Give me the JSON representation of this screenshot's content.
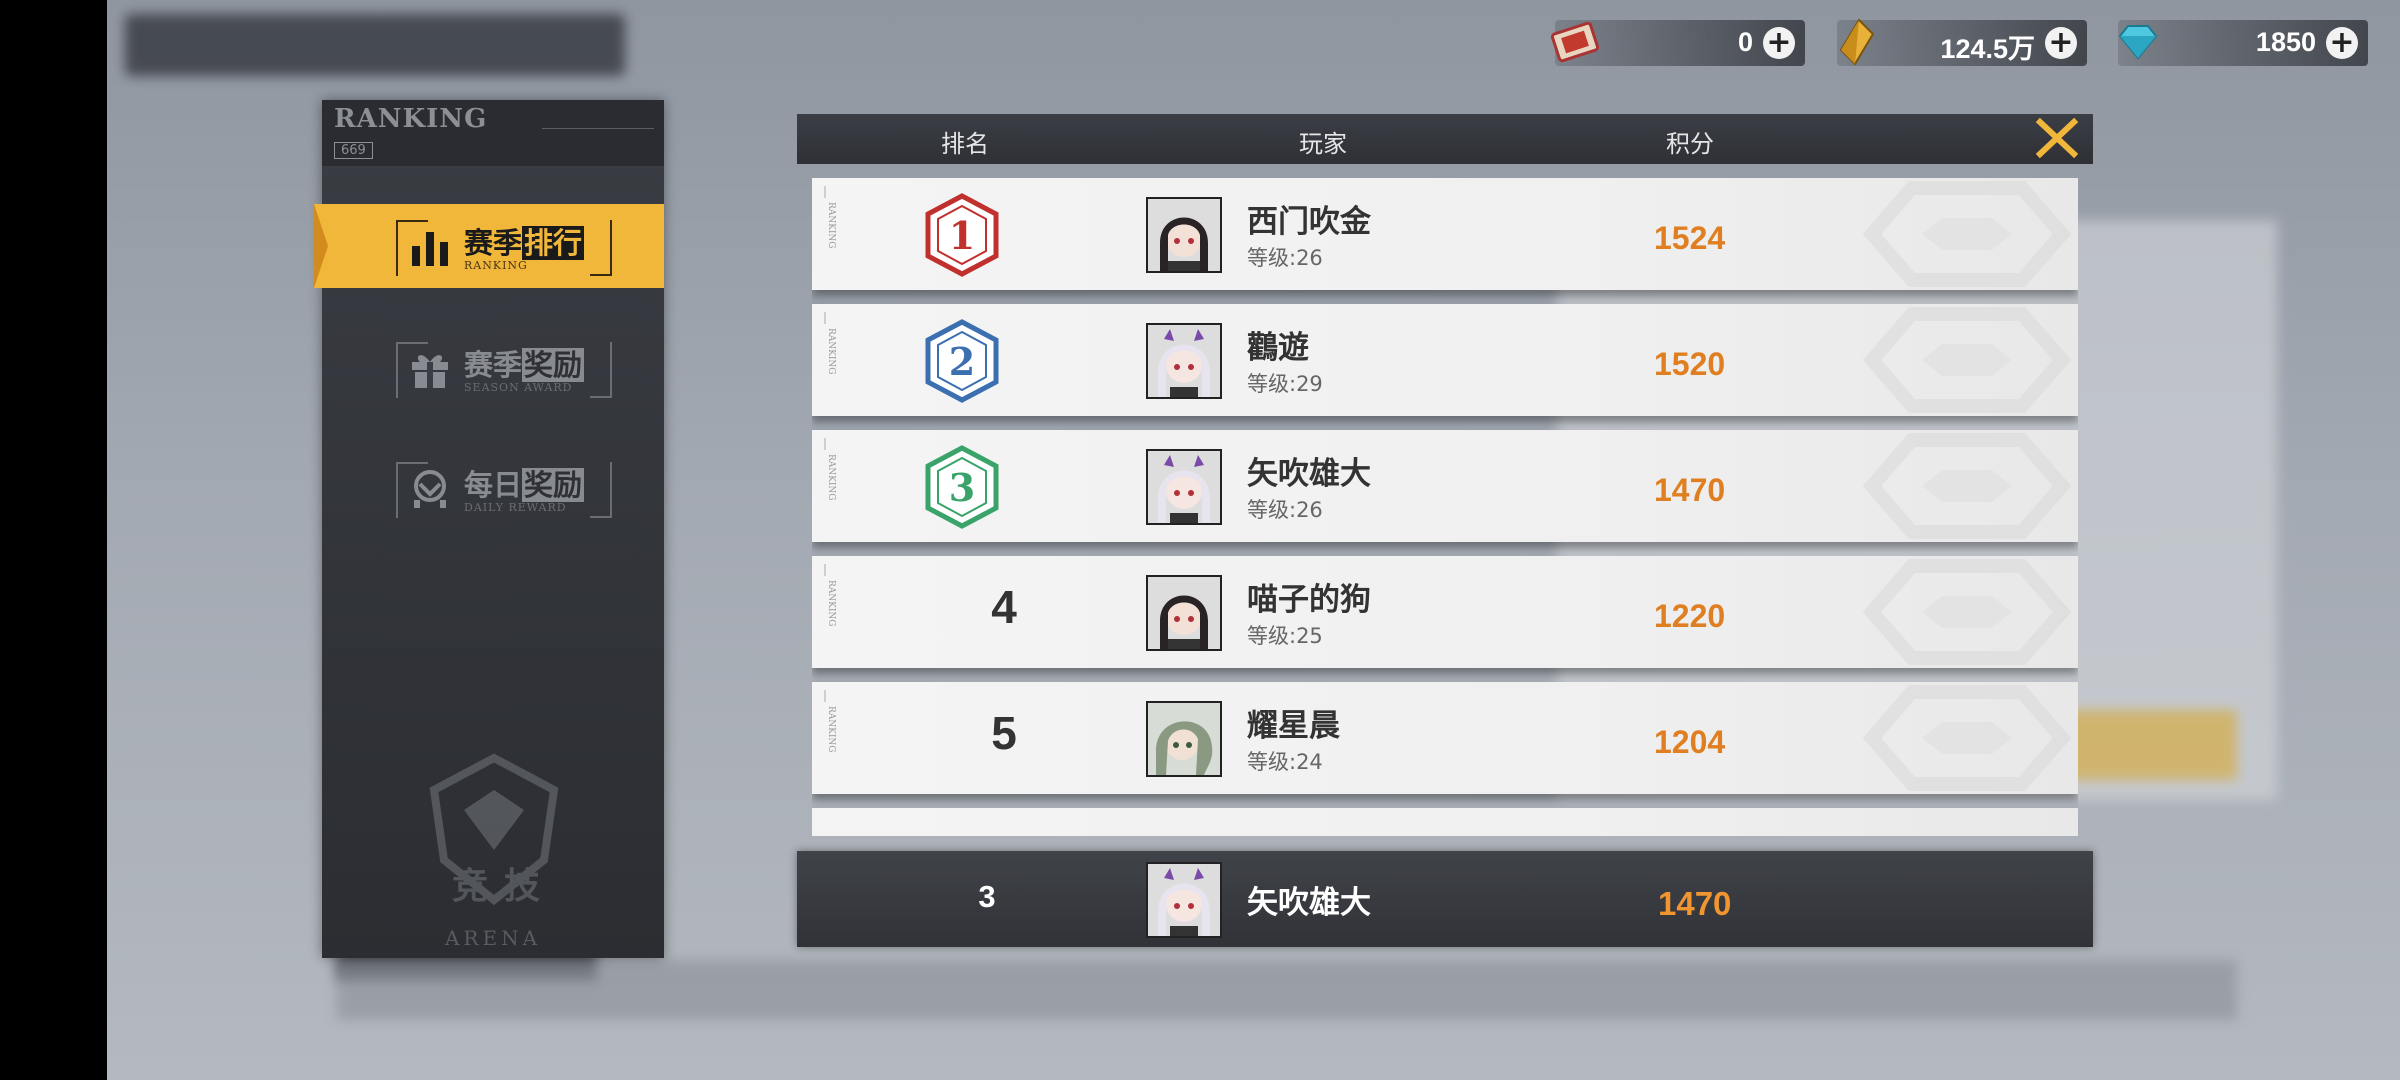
{
  "currencies": [
    {
      "name": "ticket-icon",
      "value": "0"
    },
    {
      "name": "gold-crystal-icon",
      "value": "124.5万"
    },
    {
      "name": "diamond-icon",
      "value": "1850"
    }
  ],
  "sidebar": {
    "header_title": "RANKING",
    "header_num": "669",
    "tabs": [
      {
        "label_a": "赛季",
        "label_b": "排行",
        "sub": "RANKING",
        "active": true
      },
      {
        "label_a": "赛季",
        "label_b": "奖励",
        "sub": "SEASON AWARD",
        "active": false
      },
      {
        "label_a": "每日",
        "label_b": "奖励",
        "sub": "DAILY REWARD",
        "active": false
      }
    ],
    "emblem_text_a": "竞",
    "emblem_text_b": "技",
    "footer": "ARENA"
  },
  "table": {
    "headers": {
      "rank": "排名",
      "player": "玩家",
      "score": "积分"
    },
    "side_tag": "RANKING",
    "rows": [
      {
        "rank": "1",
        "name": "西门吹金",
        "level": "等级:26",
        "score": "1524",
        "avatar": "dark-hair"
      },
      {
        "rank": "2",
        "name": "鸛遊",
        "level": "等级:29",
        "score": "1520",
        "avatar": "white-hair"
      },
      {
        "rank": "3",
        "name": "矢吹雄大",
        "level": "等级:26",
        "score": "1470",
        "avatar": "white-hair"
      },
      {
        "rank": "4",
        "name": "喵子的狗",
        "level": "等级:25",
        "score": "1220",
        "avatar": "dark-hair"
      },
      {
        "rank": "5",
        "name": "耀星晨",
        "level": "等级:24",
        "score": "1204",
        "avatar": "green-hair"
      }
    ]
  },
  "self": {
    "rank": "3",
    "name": "矢吹雄大",
    "score": "1470",
    "avatar": "white-hair"
  },
  "colors": {
    "accent": "#f0b73a",
    "score": "#e07f21",
    "rank1": "#c0312e",
    "rank2": "#3b6fb0",
    "rank3": "#3aa36a"
  }
}
